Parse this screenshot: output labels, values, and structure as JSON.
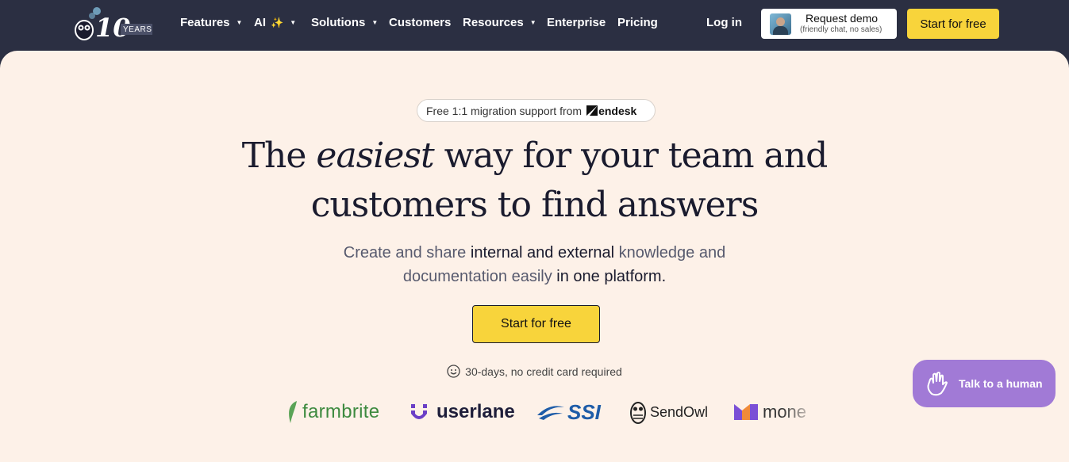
{
  "nav": {
    "logo_badge": "10",
    "logo_years": "YEARS",
    "items": [
      {
        "label": "Features",
        "has_caret": true
      },
      {
        "label": "AI",
        "has_caret": true,
        "icon": "sparkle-icon"
      },
      {
        "label": "Solutions",
        "has_caret": true
      },
      {
        "label": "Customers",
        "has_caret": false
      },
      {
        "label": "Resources",
        "has_caret": true
      },
      {
        "label": "Enterprise",
        "has_caret": false
      },
      {
        "label": "Pricing",
        "has_caret": false
      }
    ],
    "login_label": "Log in",
    "demo_title": "Request demo",
    "demo_subtitle": "(friendly chat, no sales)",
    "start_label": "Start for free"
  },
  "hero": {
    "pill_text": "Free 1:1 migration support from",
    "pill_brand": "endesk",
    "headline_pre": "The ",
    "headline_em": "easiest",
    "headline_post": " way for your team and",
    "headline_line2": "customers to find answers",
    "sub_1a": "Create and share ",
    "sub_1b": "internal and external",
    "sub_1c": " knowledge and",
    "sub_2a": "documentation easily ",
    "sub_2b": "in one platform.",
    "cta_label": "Start for free",
    "note": "30-days, no credit card required"
  },
  "logos": {
    "farmbrite": "farmbrite",
    "userlane": "userlane",
    "ssi": "SSI",
    "sendowl": "SendOwl",
    "mone": "mone"
  },
  "chat": {
    "label": "Talk to a human",
    "icon": "wave-hand-icon"
  },
  "colors": {
    "nav_bg": "#2b2f42",
    "hero_bg": "#fdf1e8",
    "accent_yellow": "#f8d43b",
    "chat_purple": "#a17ad6"
  }
}
